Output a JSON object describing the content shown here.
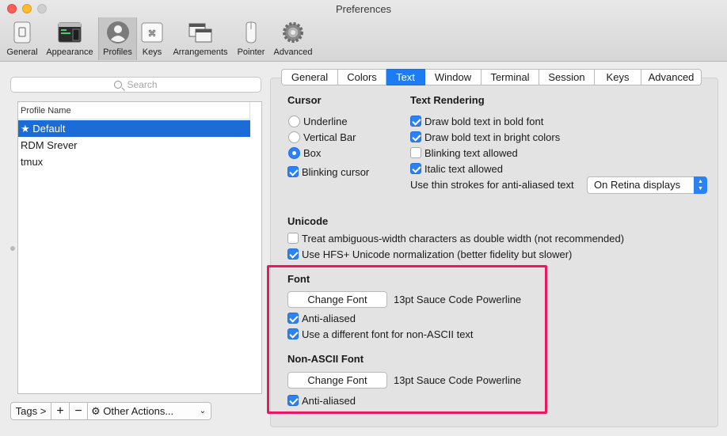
{
  "window": {
    "title": "Preferences"
  },
  "toolbar": {
    "items": [
      {
        "label": "General",
        "icon": "general-icon"
      },
      {
        "label": "Appearance",
        "icon": "appearance-icon"
      },
      {
        "label": "Profiles",
        "icon": "profiles-icon",
        "active": true
      },
      {
        "label": "Keys",
        "icon": "keys-icon"
      },
      {
        "label": "Arrangements",
        "icon": "arrangements-icon"
      },
      {
        "label": "Pointer",
        "icon": "pointer-icon"
      },
      {
        "label": "Advanced",
        "icon": "gear-icon"
      }
    ]
  },
  "sidebar": {
    "search_placeholder": "Search",
    "column_header": "Profile Name",
    "profiles": [
      "★ Default",
      "RDM Srever",
      "tmux"
    ],
    "selected_index": 0,
    "tags_label": "Tags >",
    "add_label": "+",
    "remove_label": "−",
    "other_actions_label": "Other Actions..."
  },
  "tabs": [
    {
      "label": "General"
    },
    {
      "label": "Colors"
    },
    {
      "label": "Text",
      "active": true
    },
    {
      "label": "Window"
    },
    {
      "label": "Terminal"
    },
    {
      "label": "Session"
    },
    {
      "label": "Keys"
    },
    {
      "label": "Advanced"
    }
  ],
  "cursor": {
    "title": "Cursor",
    "options": [
      "Underline",
      "Vertical Bar",
      "Box"
    ],
    "selected": "Box",
    "blinking_label": "Blinking cursor",
    "blinking": true
  },
  "text_rendering": {
    "title": "Text Rendering",
    "bold_in_bold_label": "Draw bold text in bold font",
    "bold_in_bold": true,
    "bold_in_bright_label": "Draw bold text in bright colors",
    "bold_in_bright": true,
    "blinking_text_label": "Blinking text allowed",
    "blinking_text": false,
    "italic_label": "Italic text allowed",
    "italic": true,
    "thin_strokes_label": "Use thin strokes for anti-aliased text",
    "thin_strokes_value": "On Retina displays"
  },
  "unicode": {
    "title": "Unicode",
    "ambiguous_label": "Treat ambiguous-width characters as double width (not recommended)",
    "ambiguous": false,
    "hfs_label": "Use HFS+ Unicode normalization (better fidelity but slower)",
    "hfs": true
  },
  "font": {
    "title": "Font",
    "change_label": "Change Font",
    "current": "13pt Sauce Code Powerline",
    "antialiased_label": "Anti-aliased",
    "antialiased": true,
    "non_ascii_label": "Use a different font for non-ASCII text",
    "non_ascii": true
  },
  "non_ascii_font": {
    "title": "Non-ASCII Font",
    "change_label": "Change Font",
    "current": "13pt Sauce Code Powerline",
    "antialiased_label": "Anti-aliased",
    "antialiased": true
  },
  "colors": {
    "accent": "#1d7cf2",
    "selection": "#1b6cd7",
    "highlight_box": "#e8175e"
  }
}
